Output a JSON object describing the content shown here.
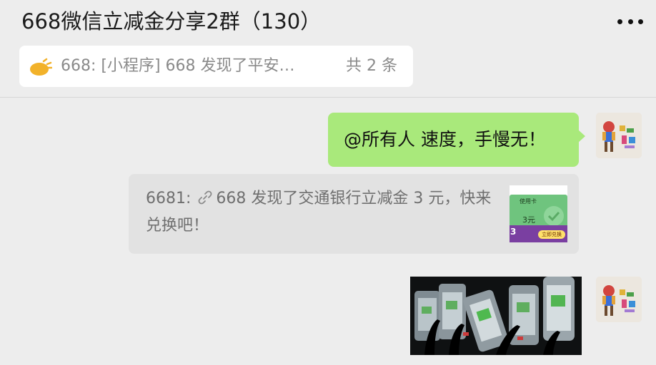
{
  "header": {
    "title": "668微信立减金分享2群（130）",
    "more_icon": "more-dots-icon"
  },
  "pinned": {
    "icon": "announcement-speaker-icon",
    "icon_color": "#f2b22a",
    "text": "668: [小程序] 668 发现了平安…",
    "count": "共 2 条"
  },
  "messages": [
    {
      "type": "text",
      "sender": "self",
      "text": "@所有人 速度，手慢无！",
      "bubble_color": "#a9e97b"
    },
    {
      "type": "quote",
      "quote_prefix": "6681: ",
      "link_icon": "link-icon",
      "quote_body": "668 发现了交通银行立减金 3 元，快来兑换吧！",
      "thumbnail": {
        "card_label": "使用卡",
        "card_value": "3元",
        "amount": "3",
        "button_label": "立即兑换"
      }
    },
    {
      "type": "image",
      "sender": "self",
      "description_icon": "phones-photo"
    }
  ],
  "colors": {
    "background": "#ededed",
    "self_bubble": "#a9e97b",
    "quote_bg": "#e2e2e2",
    "pinned_bg": "#ffffff"
  }
}
